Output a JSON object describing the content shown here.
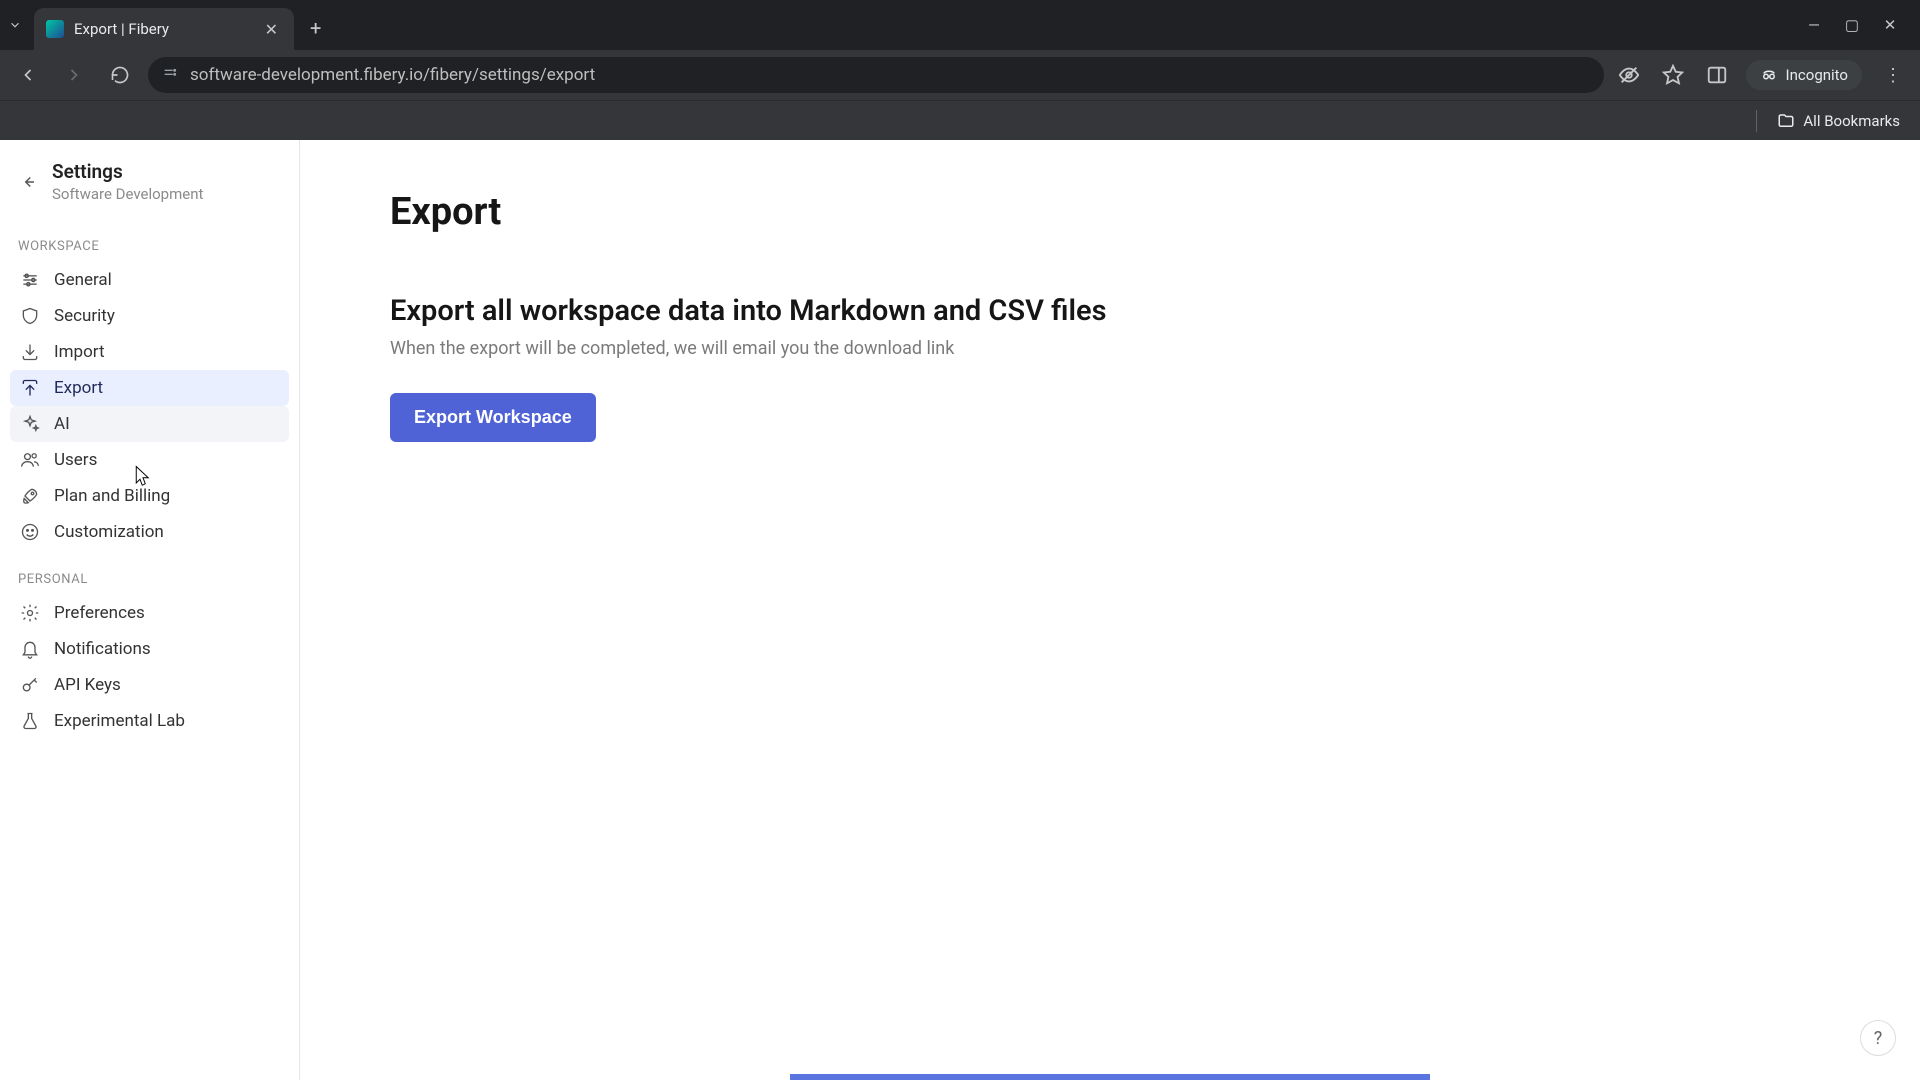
{
  "browser": {
    "tab_title": "Export | Fibery",
    "url": "software-development.fibery.io/fibery/settings/export",
    "incognito_label": "Incognito",
    "all_bookmarks": "All Bookmarks"
  },
  "sidebar": {
    "title": "Settings",
    "subtitle": "Software Development",
    "sections": [
      {
        "label": "WORKSPACE",
        "items": [
          {
            "key": "general",
            "label": "General"
          },
          {
            "key": "security",
            "label": "Security"
          },
          {
            "key": "import",
            "label": "Import"
          },
          {
            "key": "export",
            "label": "Export"
          },
          {
            "key": "ai",
            "label": "AI"
          },
          {
            "key": "users",
            "label": "Users"
          },
          {
            "key": "plan",
            "label": "Plan and Billing"
          },
          {
            "key": "customization",
            "label": "Customization"
          }
        ]
      },
      {
        "label": "PERSONAL",
        "items": [
          {
            "key": "preferences",
            "label": "Preferences"
          },
          {
            "key": "notifications",
            "label": "Notifications"
          },
          {
            "key": "apikeys",
            "label": "API Keys"
          },
          {
            "key": "lab",
            "label": "Experimental Lab"
          }
        ]
      }
    ]
  },
  "main": {
    "title": "Export",
    "subheading": "Export all workspace data into Markdown and CSV files",
    "description": "When the export will be completed, we will email you the download link",
    "button_label": "Export Workspace"
  },
  "help_label": "?"
}
